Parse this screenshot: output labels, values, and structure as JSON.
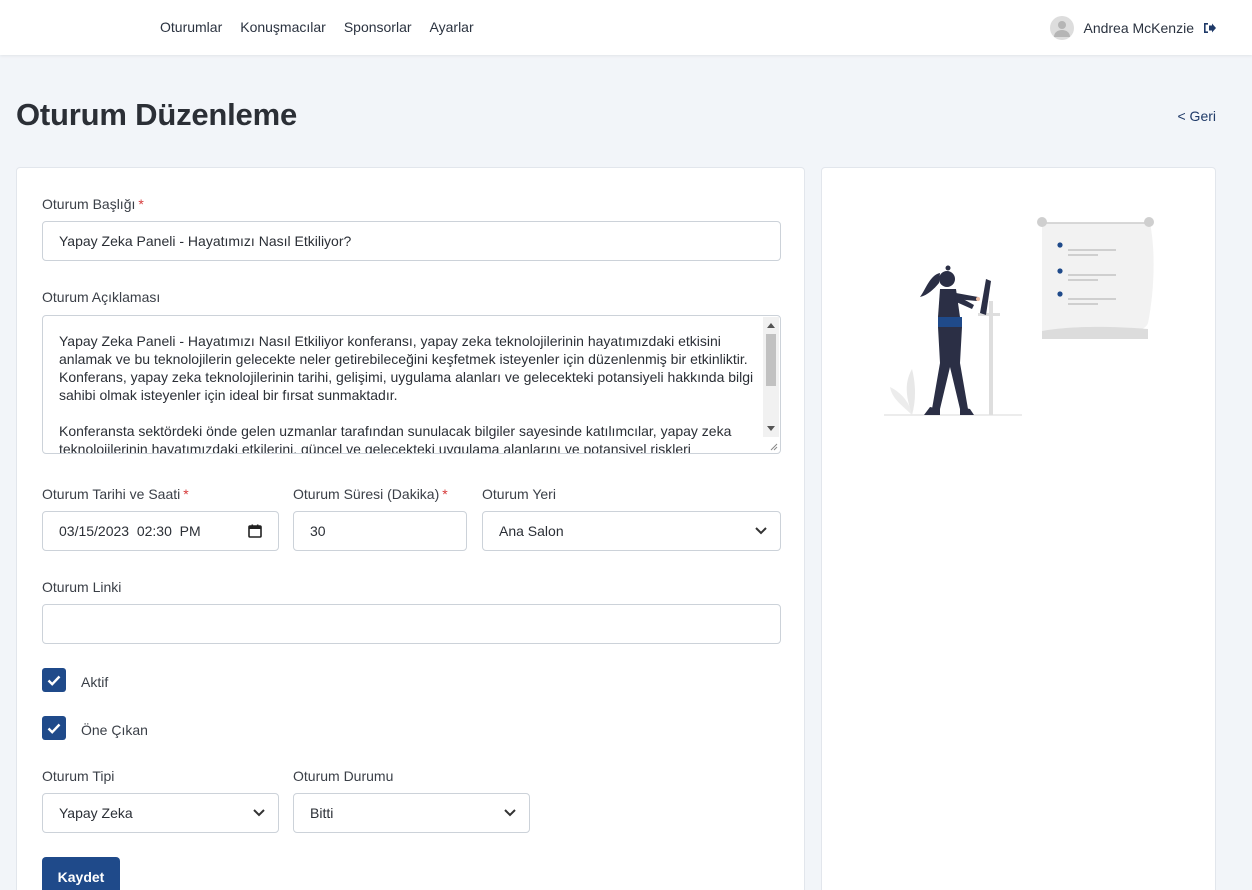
{
  "nav": {
    "items": [
      "Oturumlar",
      "Konuşmacılar",
      "Sponsorlar",
      "Ayarlar"
    ]
  },
  "user": {
    "name": "Andrea McKenzie",
    "avatar_icon": "user-avatar-icon",
    "logout_icon": "logout-icon"
  },
  "page": {
    "title": "Oturum Düzenleme",
    "back_label": "< Geri"
  },
  "form": {
    "title_label": "Oturum Başlığı",
    "title_value": "Yapay Zeka Paneli - Hayatımızı Nasıl Etkiliyor?",
    "description_label": "Oturum Açıklaması",
    "description_value": "Yapay Zeka Paneli - Hayatımızı Nasıl Etkiliyor konferansı, yapay zeka teknolojilerinin hayatımızdaki etkisini anlamak ve bu teknolojilerin gelecekte neler getirebileceğini keşfetmek isteyenler için düzenlenmiş bir etkinliktir. Konferans, yapay zeka teknolojilerinin tarihi, gelişimi, uygulama alanları ve gelecekteki potansiyeli hakkında bilgi sahibi olmak isteyenler için ideal bir fırsat sunmaktadır.\n\nKonferansta sektördeki önde gelen uzmanlar tarafından sunulacak bilgiler sayesinde katılımcılar, yapay zeka teknolojilerinin hayatımızdaki etkilerini, güncel ve gelecekteki uygulama alanlarını ve potansiyel riskleri",
    "date_label": "Oturum Tarihi ve Saati",
    "date_value": "03/15/2023  02:30  PM",
    "duration_label": "Oturum Süresi (Dakika)",
    "duration_value": "30",
    "location_label": "Oturum Yeri",
    "location_value": "Ana Salon",
    "link_label": "Oturum Linki",
    "link_value": "",
    "active_label": "Aktif",
    "active_checked": true,
    "featured_label": "Öne Çıkan",
    "featured_checked": true,
    "type_label": "Oturum Tipi",
    "type_value": "Yapay Zeka",
    "status_label": "Oturum Durumu",
    "status_value": "Bitti",
    "required_mark": "*",
    "save_label": "Kaydet"
  },
  "colors": {
    "accent": "#1f4a8a",
    "required": "#d63a3a",
    "background": "#f2f5f9"
  }
}
